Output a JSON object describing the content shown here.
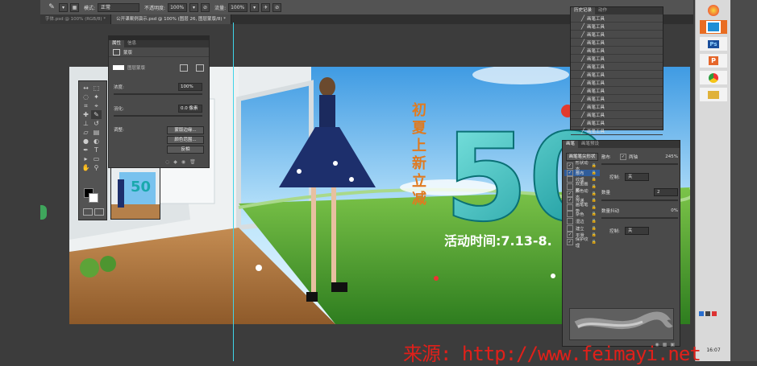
{
  "options_bar": {
    "mode_label": "模式:",
    "mode_value": "正常",
    "opacity_label": "不透明度:",
    "opacity_value": "100%",
    "flow_label": "流量:",
    "flow_value": "100%"
  },
  "tabs": [
    {
      "label": "字体.psd @ 100% (RGB/8) *"
    },
    {
      "label": "公开课案例演示.psd @ 100% (图层 26, 图层蒙版/8) *"
    }
  ],
  "properties_panel": {
    "tabs": [
      "属性",
      "信息"
    ],
    "mask_label": "蒙版",
    "layer_mask_label": "图层蒙版",
    "density_label": "浓度:",
    "density_value": "100%",
    "feather_label": "羽化:",
    "feather_value": "0.0 像素",
    "adjust_label": "调整:",
    "buttons": [
      "蒙版边缘...",
      "颜色范围...",
      "反相"
    ]
  },
  "history_panel": {
    "tabs": [
      "历史记录",
      "动作"
    ],
    "item_label": "画笔工具",
    "item_count": 15
  },
  "brush_panel": {
    "tabs": [
      "画笔",
      "画笔预设"
    ],
    "preset_button": "画笔笔尖形状",
    "scatter_label": "散布",
    "both_axes_label": "两轴",
    "scatter_value": "245%",
    "control_label": "控制:",
    "control_value": "关",
    "count_label": "数量",
    "count_value": "2",
    "count_jitter_label": "数量抖动",
    "count_jitter_value": "0%",
    "control2_label": "控制:",
    "control2_value": "关",
    "options": [
      {
        "label": "形状动态",
        "checked": true
      },
      {
        "label": "散布",
        "checked": true,
        "selected": true
      },
      {
        "label": "纹理",
        "checked": false
      },
      {
        "label": "双重画笔",
        "checked": false
      },
      {
        "label": "颜色动态",
        "checked": true
      },
      {
        "label": "传递",
        "checked": true
      },
      {
        "label": "画笔笔势",
        "checked": false
      },
      {
        "label": "杂色",
        "checked": false
      },
      {
        "label": "湿边",
        "checked": false
      },
      {
        "label": "建立",
        "checked": false
      },
      {
        "label": "平滑",
        "checked": true
      },
      {
        "label": "保护纹理",
        "checked": true
      }
    ]
  },
  "canvas": {
    "headline": "初夏上新立减",
    "big_number": "50",
    "event_time": "活动时间:7.13-8."
  },
  "taskbar": {
    "apps": [
      {
        "name": "app1",
        "color": "#1e8ed6"
      },
      {
        "name": "Ps",
        "label": "Ps",
        "color": "#1a4f9c"
      },
      {
        "name": "P",
        "label": "P",
        "color": "#e5662a"
      },
      {
        "name": "chrome",
        "color": "#e44"
      },
      {
        "name": "folder",
        "color": "#e0b23a"
      }
    ],
    "time": "16:07"
  },
  "watermark": "来源: http://www.feimayi.net"
}
